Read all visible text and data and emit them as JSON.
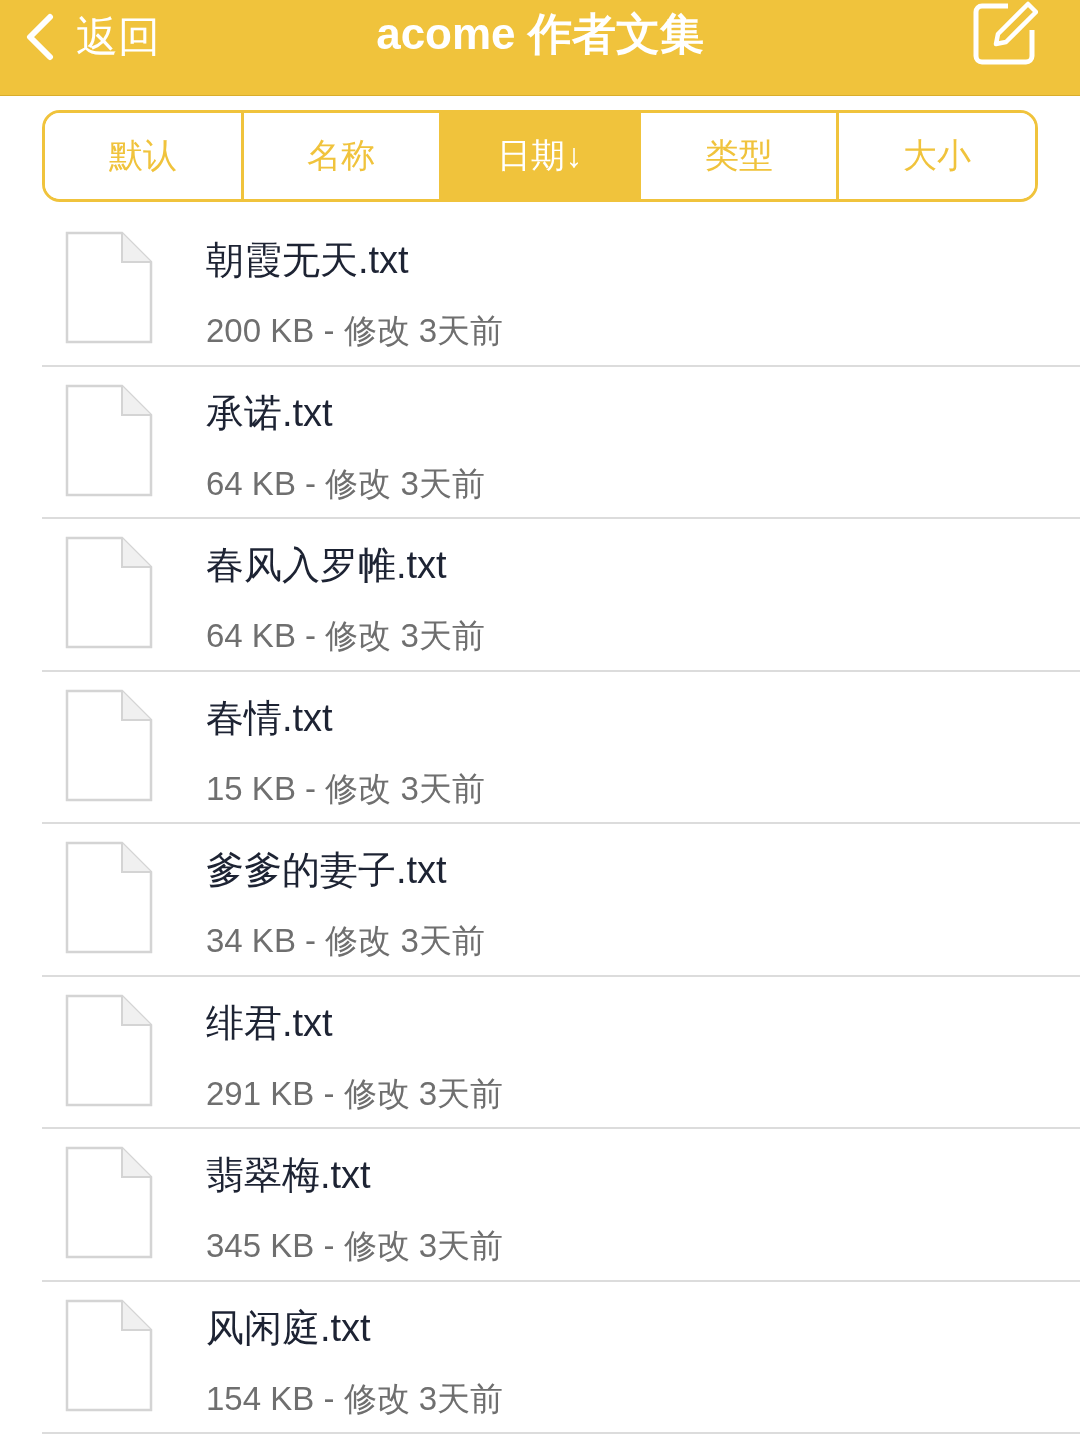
{
  "nav_bar": {
    "back_label": "返回",
    "title": "acome 作者文集"
  },
  "sort_tabs": [
    {
      "label": "默认",
      "selected": false
    },
    {
      "label": "名称",
      "selected": false
    },
    {
      "label": "日期↓",
      "selected": true
    },
    {
      "label": "类型",
      "selected": false
    },
    {
      "label": "大小",
      "selected": false
    }
  ],
  "files": [
    {
      "name": "朝霞无天.txt",
      "details": "200 KB - 修改 3天前"
    },
    {
      "name": "承诺.txt",
      "details": "64 KB - 修改 3天前"
    },
    {
      "name": "春风入罗帷.txt",
      "details": "64 KB - 修改 3天前"
    },
    {
      "name": "春情.txt",
      "details": "15 KB - 修改 3天前"
    },
    {
      "name": "爹爹的妻子.txt",
      "details": "34 KB - 修改 3天前"
    },
    {
      "name": "绯君.txt",
      "details": "291 KB - 修改 3天前"
    },
    {
      "name": "翡翠梅.txt",
      "details": "345 KB - 修改 3天前"
    },
    {
      "name": "风闲庭.txt",
      "details": "154 KB - 修改 3天前"
    }
  ]
}
